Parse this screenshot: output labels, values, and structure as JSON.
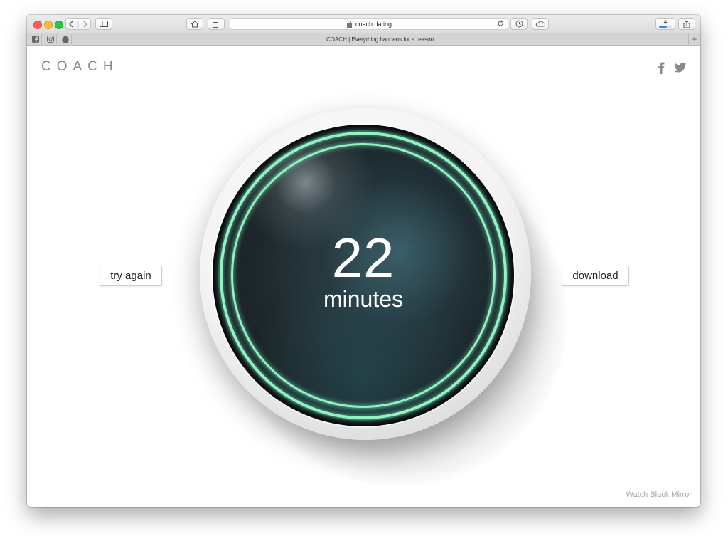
{
  "browser": {
    "url": "coach.dating",
    "tab_title": "COACH | Everything happens for a reason",
    "tab_add": "+"
  },
  "site": {
    "logo": "COACH",
    "social": [
      "facebook-icon",
      "twitter-icon"
    ]
  },
  "result": {
    "value": "22",
    "unit": "minutes",
    "ring_color": "#93f2c4"
  },
  "actions": {
    "try_again": "try again",
    "download": "download"
  },
  "footer": {
    "link": "Watch Black Mirror"
  }
}
